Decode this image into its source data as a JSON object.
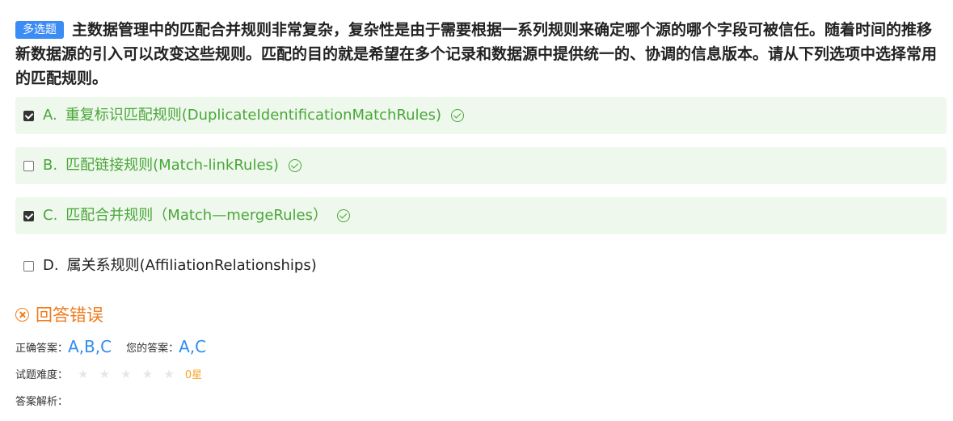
{
  "question": {
    "type_tag": "多选题",
    "text": "主数据管理中的匹配合并规则非常复杂，复杂性是由于需要根据一系列规则来确定哪个源的哪个字段可被信任。随着时间的推移新数据源的引入可以改变这些规则。匹配的目的就是希望在多个记录和数据源中提供统一的、协调的信息版本。请从下列选项中选择常用的匹配规则。"
  },
  "options": [
    {
      "key": "A.",
      "label": "重复标识匹配规则(DuplicateIdentificationMatchRules)",
      "checked": true,
      "correct": true
    },
    {
      "key": "B.",
      "label": "匹配链接规则(Match-linkRules)",
      "checked": false,
      "correct": true
    },
    {
      "key": "C.",
      "label": "匹配合并规则（Match—mergeRules）",
      "checked": true,
      "correct": true
    },
    {
      "key": "D.",
      "label": "属关系规则(AffiliationRelationships)",
      "checked": false,
      "correct": false
    }
  ],
  "result": {
    "icon": "close-circle-icon",
    "text": "回答错误"
  },
  "answers": {
    "correct_label": "正确答案：",
    "correct_value": "A,B,C",
    "yours_label": "您的答案：",
    "yours_value": "A,C"
  },
  "difficulty": {
    "label": "试题难度：",
    "stars": 0,
    "max_stars": 5,
    "value_text": "0星"
  },
  "analysis": {
    "label": "答案解析："
  },
  "colors": {
    "tag_blue": "#3b8cf5",
    "correct_green": "#4aa63a",
    "correct_bg": "#eef8ec",
    "error_orange": "#f07a1a",
    "answer_blue": "#2f8cf0",
    "star_gold": "#f5a623"
  }
}
